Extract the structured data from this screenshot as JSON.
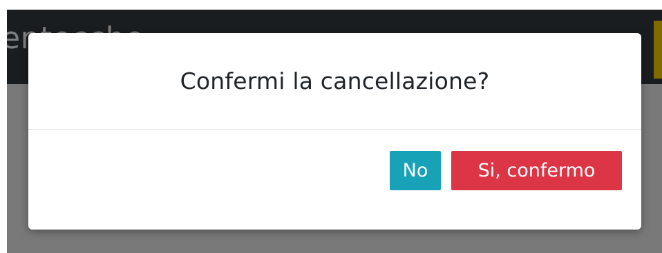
{
  "background": {
    "title": "entecche"
  },
  "dialog": {
    "title": "Confermi la cancellazione?",
    "buttons": {
      "no_label": "No",
      "confirm_label": "Si, confermo"
    }
  },
  "colors": {
    "header_bg": "#343a40",
    "accent": "#ffd600",
    "no_button": "#17a2b8",
    "confirm_button": "#dc3545",
    "overlay": "rgba(0,0,0,0.5)"
  }
}
